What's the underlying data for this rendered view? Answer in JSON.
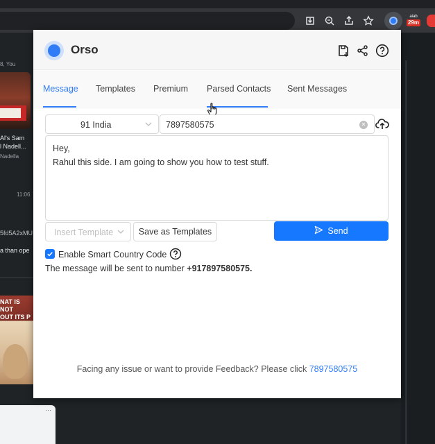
{
  "browser": {
    "toolbar_icons": [
      "download-icon",
      "zoom-icon",
      "share-icon",
      "star-icon"
    ],
    "ext_badge_top": "aiab",
    "ext_badge_count": "29m"
  },
  "background": {
    "meta": "8, You",
    "title_line1": "Al's Sam",
    "title_line2": "l Nadell...",
    "subtitle": "Nadella",
    "time": "11:06",
    "hash": "5fd5A2xMU",
    "text": "a than ope",
    "meme_line1": "NAT IS NOT",
    "meme_line2": "OUT ITS P"
  },
  "popup": {
    "app_name": "Orso",
    "tabs": [
      {
        "label": "Message"
      },
      {
        "label": "Templates"
      },
      {
        "label": "Premium"
      },
      {
        "label": "Parsed Contacts"
      },
      {
        "label": "Sent Messages"
      }
    ],
    "country": {
      "value": "91 India"
    },
    "phone": {
      "value": "7897580575"
    },
    "message": {
      "line1": "Hey,",
      "line2": "Rahul this side. I am going to show you how to test stuff."
    },
    "insert_template_placeholder": "Insert Template",
    "save_templates_label": "Save as Templates",
    "send_label": "Send",
    "smart_country_label": "Enable Smart Country Code",
    "sent_info_prefix": "The message will be sent to number ",
    "sent_info_number": "+917897580575.",
    "footer_text": "Facing any issue or want to provide Feedback? Please click ",
    "footer_link": "7897580575"
  },
  "colors": {
    "accent": "#1677ff",
    "tab_active": "#2f7cf6"
  }
}
